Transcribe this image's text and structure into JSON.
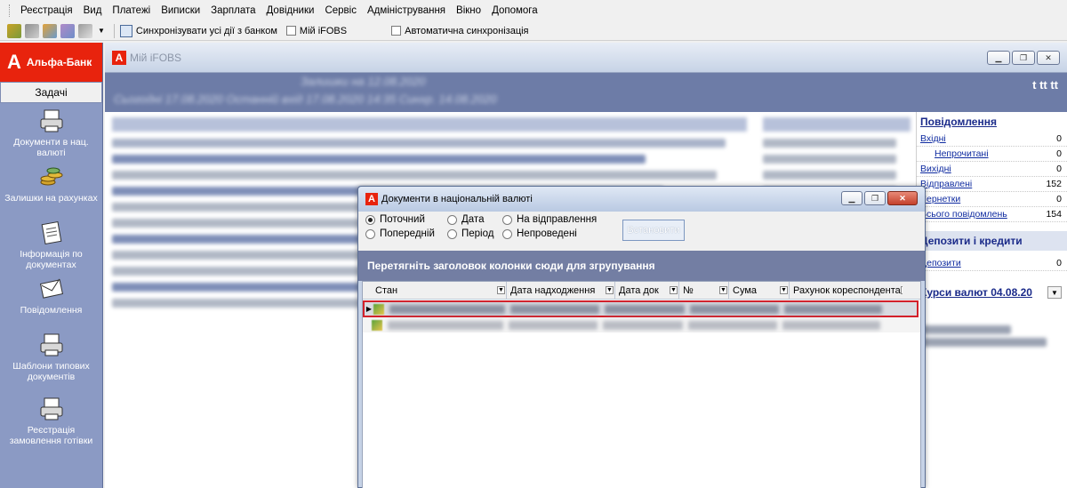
{
  "menu": [
    "Реєстрація",
    "Вид",
    "Платежі",
    "Виписки",
    "Зарплата",
    "Довідники",
    "Сервіс",
    "Адміністрування",
    "Вікно",
    "Допомога"
  ],
  "toolbar": {
    "sync_label": "Синхронізувати усі дії з банком",
    "my_ifobs_label": "Мій iFOBS",
    "auto_sync_label": "Автоматична синхронізація"
  },
  "sidebar": {
    "brand": "Альфа-Банк",
    "brand_letter": "А",
    "tasks_header": "Задачі",
    "items": [
      {
        "label": "Документи в нац. валюті",
        "icon": "document-printer-icon"
      },
      {
        "label": "Залишки на рахунках",
        "icon": "coins-icon"
      },
      {
        "label": "Інформація по документах",
        "icon": "document-info-icon"
      },
      {
        "label": "Повідомлення",
        "icon": "envelope-icon"
      },
      {
        "label": "Шаблони типових документів",
        "icon": "template-printer-icon"
      },
      {
        "label": "Реєстрація замовлення готівки",
        "icon": "cash-order-icon"
      }
    ]
  },
  "main_window": {
    "title": "Мій iFOBS",
    "user": "t tt tt",
    "banner_blur_1": "Залишки на 12.08.2020",
    "banner_blur_2": "Сьогодні 17.08.2020 Останній вхід 17.08.2020 14:35 Синхр. 14.08.2020"
  },
  "info_panel": {
    "messages_header": "Повідомлення",
    "rows": [
      {
        "label": "Вхідні",
        "value": "0",
        "indent": false
      },
      {
        "label": "Непрочитані",
        "value": "0",
        "indent": true
      },
      {
        "label": "Вихідні",
        "value": "0",
        "indent": false
      },
      {
        "label": "Відправлені",
        "value": "152",
        "indent": false
      },
      {
        "label": "Чернетки",
        "value": "0",
        "indent": false
      },
      {
        "label": "Всього повідомлень",
        "value": "154",
        "indent": false
      }
    ],
    "deposits_header": "Депозити і кредити",
    "deposits_row": {
      "label": "Депозити",
      "value": "0"
    },
    "rates_header": "Курси валют 04.08.20"
  },
  "dialog": {
    "title": "Документи в національній валюті",
    "radios": [
      {
        "label": "Поточний",
        "checked": true
      },
      {
        "label": "Дата",
        "checked": false
      },
      {
        "label": "На відправлення",
        "checked": false
      },
      {
        "label": "Попередній",
        "checked": false
      },
      {
        "label": "Період",
        "checked": false
      },
      {
        "label": "Непроведені",
        "checked": false
      }
    ],
    "set_button": "Встановити",
    "group_hint": "Перетягніть заголовок колонки сюди для згрупування",
    "columns": [
      "Стан",
      "Дата надходження",
      "Дата док",
      "№",
      "Сума",
      "Рахунок кореспондента"
    ]
  }
}
